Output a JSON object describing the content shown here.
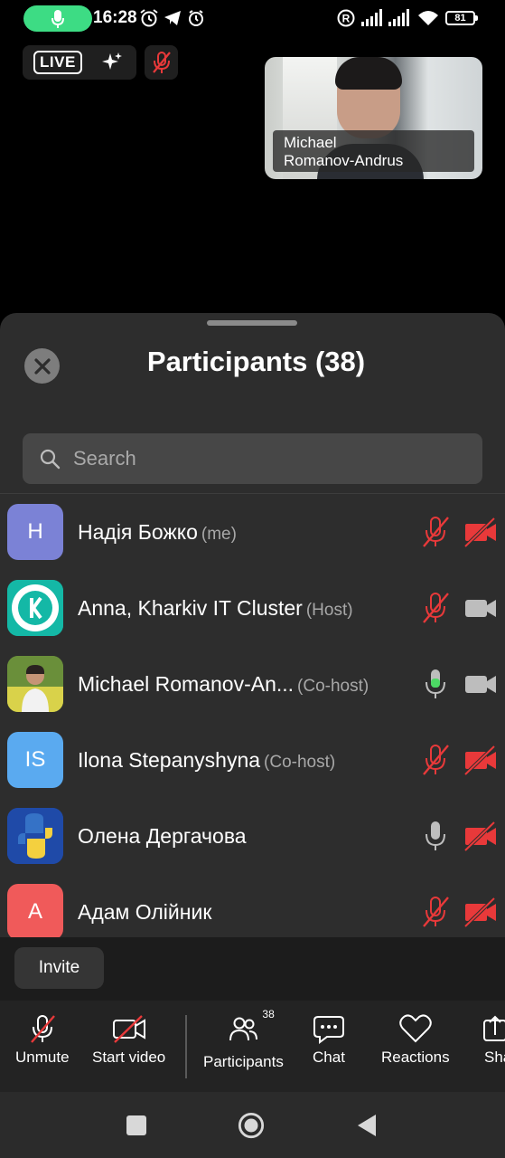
{
  "status_bar": {
    "time": "16:28",
    "battery": "81",
    "icons": [
      "mic-active-icon",
      "alarm-icon",
      "telegram-icon",
      "clock-icon",
      "r-circle-icon",
      "signal-icon",
      "signal-icon",
      "wifi-icon",
      "battery-icon"
    ]
  },
  "meeting": {
    "live_label": "LIVE",
    "video_tile_name": "Michael\nRomanov-Andrus"
  },
  "participants_sheet": {
    "title": "Participants (38)",
    "search_placeholder": "Search",
    "participants": [
      {
        "initials": "H",
        "name": "Надія Божко",
        "role": "(me)",
        "avatar_color": "#7b82d6",
        "mic": "muted",
        "camera": "off"
      },
      {
        "initials": "",
        "name": "Anna, Kharkiv IT Cluster",
        "role": "(Host)",
        "avatar_color": "#14b8a6",
        "mic": "muted",
        "camera": "on"
      },
      {
        "initials": "",
        "name": "Michael Romanov-An...",
        "role": "(Co-host)",
        "avatar_color": "#6a8f3a",
        "mic": "speaking",
        "camera": "on"
      },
      {
        "initials": "IS",
        "name": "Ilona Stepanyshyna",
        "role": "(Co-host)",
        "avatar_color": "#5aaaf0",
        "mic": "muted",
        "camera": "off"
      },
      {
        "initials": "",
        "name": "Олена Дергачова",
        "role": "",
        "avatar_color": "#1f4aa8",
        "mic": "on",
        "camera": "off"
      },
      {
        "initials": "A",
        "name": "Адам Олійник",
        "role": "",
        "avatar_color": "#f05a5a",
        "mic": "muted",
        "camera": "off"
      }
    ],
    "invite_label": "Invite"
  },
  "toolbar": {
    "unmute": "Unmute",
    "start_video": "Start video",
    "participants": "Participants",
    "participants_count": "38",
    "chat": "Chat",
    "reactions": "Reactions",
    "share": "Share"
  },
  "colors": {
    "muted_red": "#e8393a",
    "speaking_green": "#4cd964",
    "sheet_bg": "#2d2d2d"
  }
}
